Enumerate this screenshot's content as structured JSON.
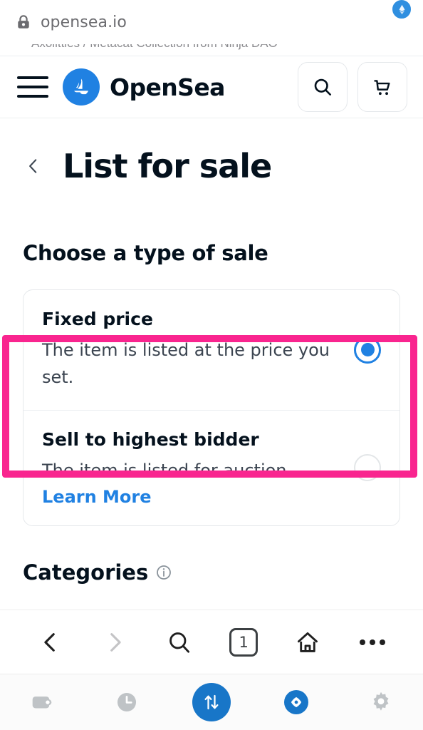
{
  "browser": {
    "url": "opensea.io",
    "lock_icon": "lock-icon",
    "avatar_icon": "wallet-avatar",
    "network_badge_icon": "ethereum-badge-icon",
    "cut_off_breadcrumb": "Axolittles   /   Metacat Collection from Ninja DAO",
    "nav": {
      "back_label": "Back",
      "forward_label": "Forward",
      "search_label": "Search",
      "tab_count": "1",
      "home_label": "Home",
      "more_label": "More options"
    }
  },
  "site_header": {
    "menu_label": "Menu",
    "logo_icon": "opensea-sailboat-logo",
    "brand": "OpenSea",
    "search_label": "Search",
    "cart_label": "Cart"
  },
  "page": {
    "back_label": "Back",
    "title": "List for sale",
    "section_title": "Choose a type of sale",
    "next_section_title": "Categories"
  },
  "sale_types": [
    {
      "name": "Fixed price",
      "description": "The item is listed at the price you set.",
      "selected": true,
      "link_label": ""
    },
    {
      "name": "Sell to highest bidder",
      "description": "The item is listed for auction.",
      "selected": false,
      "link_label": "Learn More"
    }
  ],
  "annotation": {
    "target": "Fixed price",
    "color": "#f9258f"
  },
  "app_tabbar": {
    "items": [
      {
        "label": "Wallet",
        "icon": "wallet-icon",
        "active": false
      },
      {
        "label": "History",
        "icon": "clock-icon",
        "active": false
      },
      {
        "label": "Swap",
        "icon": "swap-arrows-icon",
        "active": true
      },
      {
        "label": "Browser",
        "icon": "compass-icon",
        "active": true
      },
      {
        "label": "Settings",
        "icon": "gear-icon",
        "active": false
      }
    ]
  },
  "colors": {
    "accent_blue": "#2081e2",
    "highlight_pink": "#f9258f",
    "text_dark": "#04111d"
  }
}
